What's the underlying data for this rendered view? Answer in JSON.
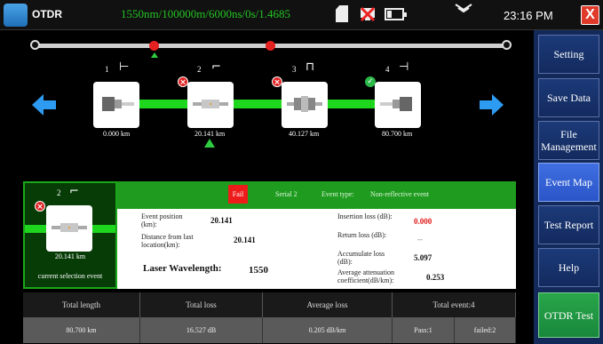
{
  "topbar": {
    "app_title": "OTDR",
    "params": "1550nm/100000m/6000ns/0s/1.4685",
    "time": "23:16 PM",
    "close_label": "X"
  },
  "menu": [
    {
      "label": "Setting"
    },
    {
      "label": "Save Data"
    },
    {
      "label": "File Management"
    },
    {
      "label": "Event Map"
    },
    {
      "label": "Test Report"
    },
    {
      "label": "Help"
    },
    {
      "label": "OTDR Test"
    }
  ],
  "events": [
    {
      "num": "1",
      "symbol": "⊢",
      "km": "0.000 km",
      "status": "none"
    },
    {
      "num": "2",
      "symbol": "⌐",
      "km": "20.141 km",
      "status": "fail"
    },
    {
      "num": "3",
      "symbol": "⊓",
      "km": "40.127 km",
      "status": "fail"
    },
    {
      "num": "4",
      "symbol": "⊣",
      "km": "80.700 km",
      "status": "pass"
    }
  ],
  "selected": {
    "num": "2",
    "symbol": "⌐",
    "km": "20.141 km",
    "caption": "current selection event"
  },
  "detail": {
    "result": "Fail",
    "serial": "Serial 2",
    "event_type": "Event type:",
    "event_type_value": "Non-reflective event",
    "event_position_label": "Event position (km):",
    "event_position": "20.141",
    "distance_label": "Distance from last location(km):",
    "distance": "20.141",
    "laser_label": "Laser Wavelength:",
    "laser": "1550",
    "insertion_loss_label": "Insertion loss (dB):",
    "insertion_loss": "0.000",
    "return_loss_label": "Return loss (dB):",
    "return_loss": "--",
    "accumulate_loss_label": "Accumulate loss (dB):",
    "accumulate_loss": "5.097",
    "avg_atten_label": "Average attenuation coefficient(dB/km):",
    "avg_atten": "0.253"
  },
  "summary": {
    "headers": [
      "Total length",
      "Total loss",
      "Average loss",
      "Total event:4"
    ],
    "total_length": "80.700 km",
    "total_loss": "16.527 dB",
    "average_loss": "0.205 dB/km",
    "pass": "Pass:1",
    "failed": "failed:2"
  },
  "colors": {
    "accent_green": "#1fd61f",
    "fail_red": "#e22222",
    "panel_blue": "#12295a",
    "active_blue": "#3f6fe2"
  }
}
